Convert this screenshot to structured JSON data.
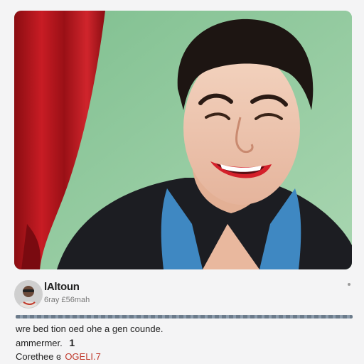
{
  "post": {
    "image_icon": "comedian-portrait-illustration",
    "author": {
      "name": "lAltoun",
      "handle": "6ray £56mah",
      "avatar_icon": "avatar-photo-icon"
    },
    "more_icon": "more-options-icon",
    "caption": "wre bed tion oed ohe a gen counde.",
    "stat_label": "ammermer.",
    "stat_value": "1",
    "footer_label": "Corethee ɞ",
    "footer_accent": "OGELI.7"
  },
  "colors": {
    "background": "#f4f4f5",
    "image_bg": "#8ec79c",
    "curtain": "#b5141d",
    "accent": "#c0392b"
  }
}
